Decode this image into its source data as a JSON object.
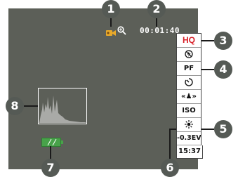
{
  "screen": {
    "recording_time": "00:01:40",
    "panel": {
      "quality": "HQ",
      "flash_icon": "flash-off-icon",
      "color_filter": "PF",
      "self_timer_icon": "self-timer-icon",
      "face_detect": "«♟»",
      "iso": "ISO",
      "white_balance_icon": "white-balance-icon",
      "exposure_compensation": "-0.3EV",
      "clock": "15:37"
    },
    "histogram_label": "histogram",
    "battery_icon": "battery-icon",
    "recording_icon": "movie-recording-icon",
    "zoom_icon": "zoom-icon"
  },
  "callouts": [
    "1",
    "2",
    "3",
    "4",
    "5",
    "6",
    "7",
    "8"
  ],
  "colors": {
    "screen_bg": "#5c5f58",
    "quality_red": "#d8222a",
    "callout_bg": "#555a55",
    "histogram_fill": "#a9aaa7"
  }
}
